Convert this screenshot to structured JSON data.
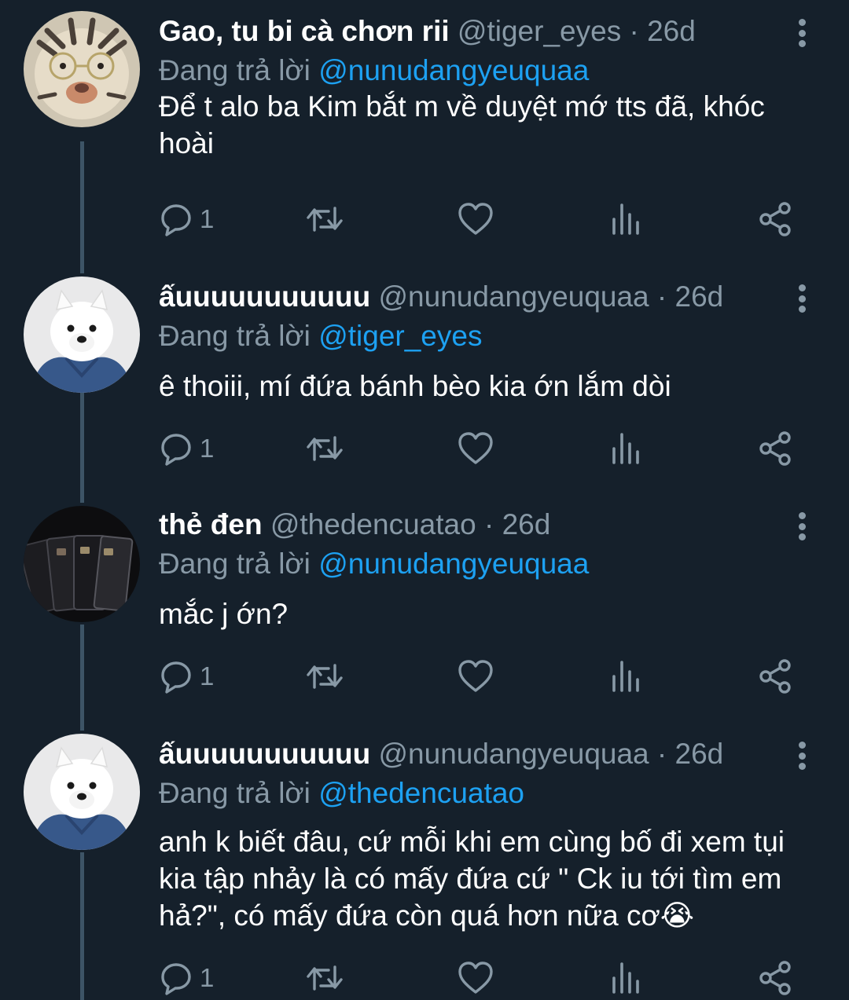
{
  "colors": {
    "background": "#15202b",
    "secondary_text": "#8899a6",
    "link": "#1da1f2",
    "thread_line": "#3d5466"
  },
  "tweets": [
    {
      "avatar": "tiger-plush-avatar",
      "name": "Gao, tu bi cà chơn rii",
      "handle": "@tiger_eyes",
      "dot": "·",
      "time": "26d",
      "reply_label": "Đang trả lời",
      "reply_to": "@nunudangyeuquaa",
      "text": "Để t alo ba Kim bắt m về duyệt mớ tts đã, khóc hoài",
      "reply_count": "1"
    },
    {
      "avatar": "samoyed-dog-avatar",
      "name": "ấuuuuuuuuuuu",
      "handle": "@nunudangyeuquaa",
      "dot": "·",
      "time": "26d",
      "reply_label": "Đang trả lời",
      "reply_to": "@tiger_eyes",
      "text": "ê thoiii, mí đứa bánh bèo kia ớn lắm dòi",
      "reply_count": "1"
    },
    {
      "avatar": "black-cards-avatar",
      "name": "thẻ đen",
      "handle": "@thedencuatao",
      "dot": "·",
      "time": "26d",
      "reply_label": "Đang trả lời",
      "reply_to": "@nunudangyeuquaa",
      "text": "mắc j ớn?",
      "reply_count": "1"
    },
    {
      "avatar": "samoyed-dog-avatar",
      "name": "ấuuuuuuuuuuu",
      "handle": "@nunudangyeuquaa",
      "dot": "·",
      "time": "26d",
      "reply_label": "Đang trả lời",
      "reply_to": "@thedencuatao",
      "text": "anh k biết đâu, cứ mỗi khi em cùng bố đi xem tụi kia tập nhảy là có mấy đứa cứ \" Ck iu tới tìm em hả?\", có mấy đứa còn quá hơn nữa cơ😭",
      "reply_count": "1"
    }
  ],
  "icons": {
    "reply": "reply-bubble-icon",
    "retweet": "retweet-icon",
    "like": "heart-icon",
    "analytics": "bar-chart-icon",
    "share": "share-icon",
    "more": "more-vertical-icon"
  }
}
